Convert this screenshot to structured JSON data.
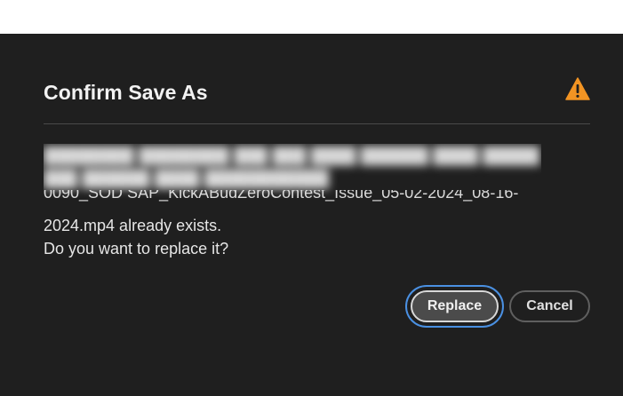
{
  "dialog": {
    "title": "Confirm Save As",
    "warning_icon": "warning-triangle-icon",
    "accent_color": "#f29423",
    "focus_color": "#4a90e2",
    "path_partial": "0090_SOD SAP_KickABudZeroContest_Issue_05-02-2024_08-16-",
    "message_line1": "2024.mp4 already exists.",
    "message_line2": "Do you want to replace it?",
    "buttons": {
      "replace_label": "Replace",
      "cancel_label": "Cancel"
    }
  }
}
